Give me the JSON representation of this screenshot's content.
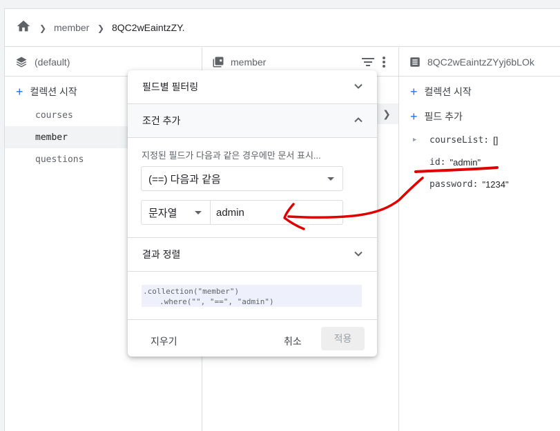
{
  "breadcrumb": {
    "items": [
      "member",
      "8QC2wEaintzZY."
    ]
  },
  "columns": {
    "root": {
      "title": "(default)",
      "action": "컬렉션 시작",
      "collections": [
        {
          "name": "courses",
          "selected": false
        },
        {
          "name": "member",
          "selected": true
        },
        {
          "name": "questions",
          "selected": false
        }
      ]
    },
    "collection": {
      "title": "member"
    },
    "document": {
      "title": "8QC2wEaintzZYyj6bLOk",
      "start_collection": "컬렉션 시작",
      "add_field": "필드 추가",
      "fields": [
        {
          "key": "courseList:",
          "value": "[]",
          "expandable": true
        },
        {
          "key": "id:",
          "value": "\"admin\"",
          "expandable": false
        },
        {
          "key": "password:",
          "value": "\"1234\"",
          "expandable": false
        }
      ]
    }
  },
  "filter_popup": {
    "field_filter_label": "필드별 필터링",
    "add_condition_label": "조건 추가",
    "hint": "지정된 필드가 다음과 같은 경우에만 문서 표시...",
    "operator": "(==) 다음과 같음",
    "value_type": "문자열",
    "value": "admin",
    "sort_label": "결과 정렬",
    "query_line1": ".collection(\"member\")",
    "query_line2": ".where(\"\", \"==\", \"admin\")",
    "clear_label": "지우기",
    "cancel_label": "취소",
    "apply_label": "적용"
  },
  "colors": {
    "accent": "#1a73e8",
    "annotation": "#e00000"
  }
}
